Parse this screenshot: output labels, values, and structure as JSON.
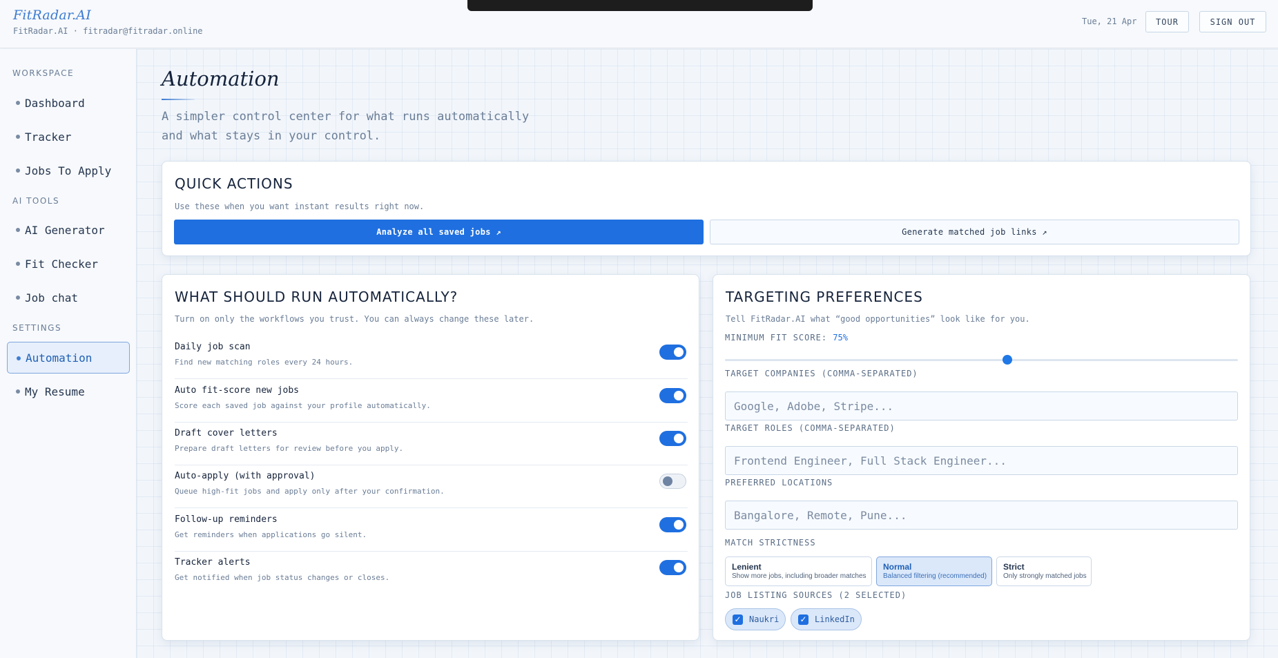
{
  "header": {
    "brand": "FitRadar.AI",
    "brand_sub": "FitRadar.AI · fitradar@fitradar.online",
    "date": "Tue, 21 Apr",
    "tour_label": "TOUR",
    "signout_label": "SIGN OUT"
  },
  "sidebar": {
    "sections": [
      {
        "label": "WORKSPACE",
        "items": [
          "Dashboard",
          "Tracker",
          "Jobs To Apply"
        ]
      },
      {
        "label": "AI TOOLS",
        "items": [
          "AI Generator",
          "Fit Checker",
          "Job chat"
        ]
      },
      {
        "label": "SETTINGS",
        "items": [
          "Automation",
          "My Resume"
        ]
      }
    ],
    "active": "Automation"
  },
  "page": {
    "title": "Automation",
    "subtitle": "A simpler control center for what runs automatically and what stays in your control."
  },
  "quick_actions": {
    "title": "QUICK ACTIONS",
    "subtitle": "Use these when you want instant results right now.",
    "primary_label": "Analyze all saved jobs ↗",
    "secondary_label": "Generate matched job links ↗"
  },
  "automation": {
    "title": "WHAT SHOULD RUN AUTOMATICALLY?",
    "subtitle": "Turn on only the workflows you trust. You can always change these later.",
    "rows": [
      {
        "title": "Daily job scan",
        "desc": "Find new matching roles every 24 hours.",
        "on": true
      },
      {
        "title": "Auto fit-score new jobs",
        "desc": "Score each saved job against your profile automatically.",
        "on": true
      },
      {
        "title": "Draft cover letters",
        "desc": "Prepare draft letters for review before you apply.",
        "on": true
      },
      {
        "title": "Auto-apply (with approval)",
        "desc": "Queue high-fit jobs and apply only after your confirmation.",
        "on": false
      },
      {
        "title": "Follow-up reminders",
        "desc": "Get reminders when applications go silent.",
        "on": true
      },
      {
        "title": "Tracker alerts",
        "desc": "Get notified when job status changes or closes.",
        "on": true
      }
    ]
  },
  "targeting": {
    "title": "TARGETING PREFERENCES",
    "subtitle": "Tell FitRadar.AI what “good opportunities” look like for you.",
    "min_fit_label": "MINIMUM FIT SCORE:",
    "min_fit_value": "75%",
    "min_fit_fraction": 0.55,
    "companies_label": "TARGET COMPANIES (COMMA-SEPARATED)",
    "companies_placeholder": "Google, Adobe, Stripe...",
    "roles_label": "TARGET ROLES (COMMA-SEPARATED)",
    "roles_placeholder": "Frontend Engineer, Full Stack Engineer...",
    "locations_label": "PREFERRED LOCATIONS",
    "locations_placeholder": "Bangalore, Remote, Pune...",
    "strictness_label": "MATCH STRICTNESS",
    "strictness_options": [
      {
        "title": "Lenient",
        "desc": "Show more jobs, including broader matches"
      },
      {
        "title": "Normal",
        "desc": "Balanced filtering (recommended)"
      },
      {
        "title": "Strict",
        "desc": "Only strongly matched jobs"
      }
    ],
    "strictness_selected": "Normal",
    "sources_label": "JOB LISTING SOURCES (2 SELECTED)",
    "sources": [
      "Naukri",
      "LinkedIn"
    ]
  },
  "colors": {
    "accent": "#1f6fe0",
    "brand": "#3b7ad1"
  }
}
